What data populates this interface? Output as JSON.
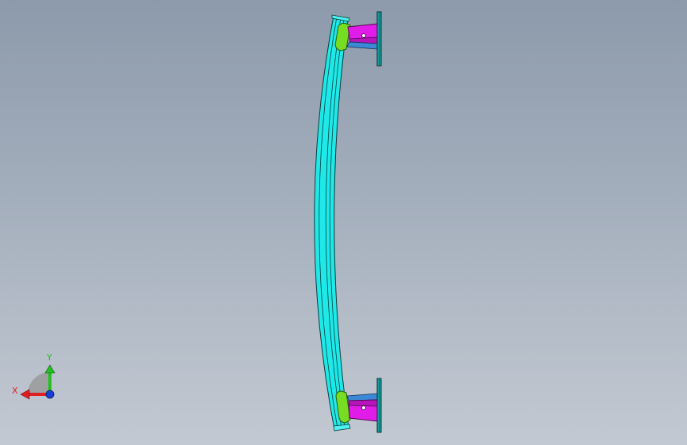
{
  "viewport": {
    "background_top": "#8d9aab",
    "background_bottom": "#c3c9d2"
  },
  "model": {
    "parts": [
      {
        "name": "curved-beam",
        "color": "#1fe8e8"
      },
      {
        "name": "top-pad",
        "color": "#77dd22"
      },
      {
        "name": "bottom-pad",
        "color": "#77dd22"
      },
      {
        "name": "top-bracket",
        "color": "#e21ce8"
      },
      {
        "name": "bottom-bracket",
        "color": "#e21ce8"
      },
      {
        "name": "base-plate",
        "color": "#1aa6a6"
      }
    ]
  },
  "triad": {
    "x_label": "X",
    "y_label": "Y",
    "x_color": "#e02020",
    "y_color": "#22c022",
    "z_color": "#1a3fd6"
  }
}
